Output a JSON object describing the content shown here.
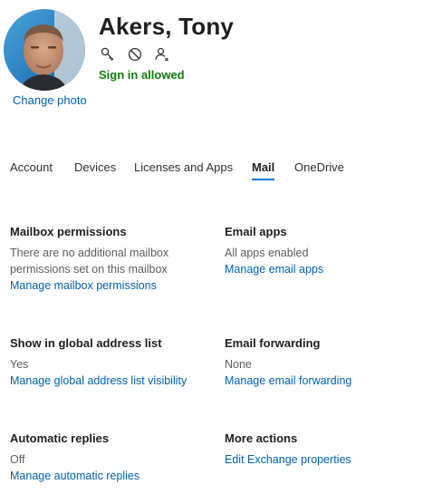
{
  "user": {
    "name": "Akers, Tony",
    "change_photo_label": "Change photo",
    "sign_in_status": "Sign in allowed",
    "status_color": "#107c10",
    "action_icons": [
      "key-icon",
      "block-icon",
      "user-remove-icon"
    ]
  },
  "tabs": [
    {
      "label": "Account",
      "active": false
    },
    {
      "label": "Devices",
      "active": false
    },
    {
      "label": "Licenses and Apps",
      "active": false
    },
    {
      "label": "Mail",
      "active": true
    },
    {
      "label": "OneDrive",
      "active": false
    }
  ],
  "sections": {
    "mailbox_permissions": {
      "title": "Mailbox permissions",
      "value_line1": "There are no additional mailbox",
      "value_line2": "permissions set on this mailbox",
      "link": "Manage mailbox permissions"
    },
    "email_apps": {
      "title": "Email apps",
      "value": "All apps enabled",
      "link": "Manage email apps"
    },
    "global_address_list": {
      "title": "Show in global address list",
      "value": "Yes",
      "link": "Manage global address list visibility"
    },
    "email_forwarding": {
      "title": "Email forwarding",
      "value": "None",
      "link": "Manage email forwarding"
    },
    "automatic_replies": {
      "title": "Automatic replies",
      "value": "Off",
      "link": "Manage automatic replies"
    },
    "more_actions": {
      "title": "More actions",
      "link": "Edit Exchange properties"
    }
  },
  "colors": {
    "link": "#0063b1",
    "accent": "#0078d4",
    "text": "#323130",
    "muted": "#605e5c"
  }
}
